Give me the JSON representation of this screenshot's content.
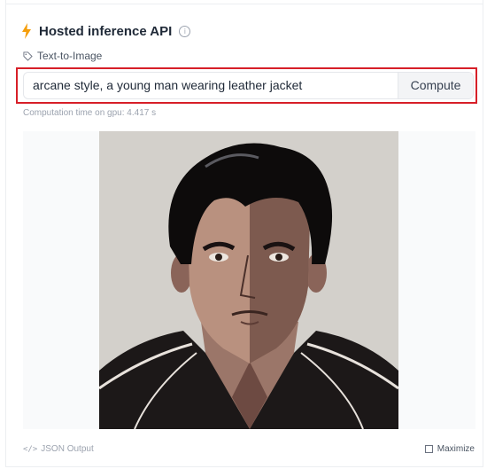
{
  "widget": {
    "title": "Hosted inference API",
    "task_label": "Text-to-Image",
    "prompt_value": "arcane style, a young man wearing leather jacket",
    "compute_label": "Compute",
    "computation_time": "Computation time on gpu: 4.417 s",
    "json_output_label": "JSON Output",
    "maximize_label": "Maximize",
    "icons": {
      "title": "lightning-bolt-icon",
      "info": "info-icon",
      "task": "tag-icon",
      "json": "code-icon",
      "maximize": "maximize-icon"
    },
    "colors": {
      "accent": "#f59e0b",
      "highlight_border": "#d71f28"
    }
  }
}
